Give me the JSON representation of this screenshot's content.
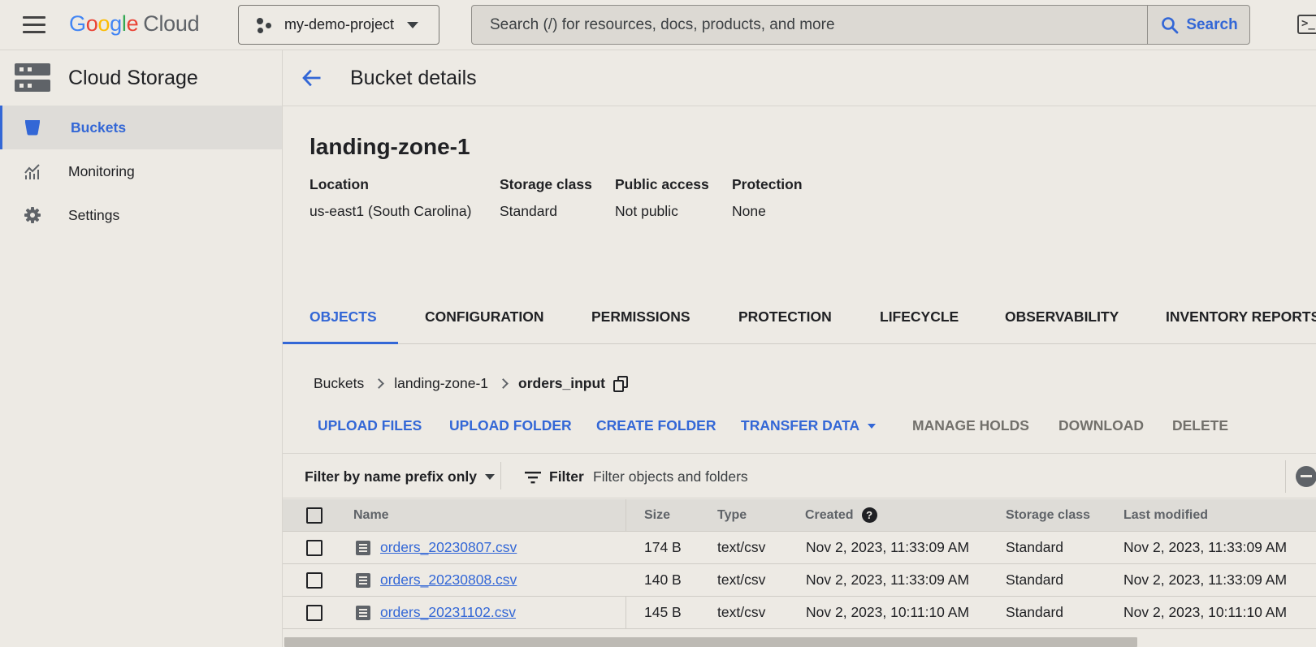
{
  "topbar": {
    "logo_google": [
      "G",
      "o",
      "o",
      "g",
      "l",
      "e"
    ],
    "logo_cloud": "Cloud",
    "project": "my-demo-project",
    "search_placeholder": "Search (/) for resources, docs, products, and more",
    "search_button": "Search"
  },
  "sidebar": {
    "title": "Cloud Storage",
    "items": [
      {
        "label": "Buckets",
        "icon": "bucket-icon",
        "active": true
      },
      {
        "label": "Monitoring",
        "icon": "monitoring-chart-icon",
        "active": false
      },
      {
        "label": "Settings",
        "icon": "gear-icon",
        "active": false
      }
    ]
  },
  "page": {
    "title": "Bucket details",
    "bucket_name": "landing-zone-1",
    "info": [
      {
        "key": "Location",
        "value": "us-east1 (South Carolina)"
      },
      {
        "key": "Storage class",
        "value": "Standard"
      },
      {
        "key": "Public access",
        "value": "Not public"
      },
      {
        "key": "Protection",
        "value": "None"
      }
    ]
  },
  "tabs": [
    "OBJECTS",
    "CONFIGURATION",
    "PERMISSIONS",
    "PROTECTION",
    "LIFECYCLE",
    "OBSERVABILITY",
    "INVENTORY REPORTS"
  ],
  "active_tab": "OBJECTS",
  "breadcrumb": [
    "Buckets",
    "landing-zone-1",
    "orders_input"
  ],
  "actions": {
    "upload_files": "UPLOAD FILES",
    "upload_folder": "UPLOAD FOLDER",
    "create_folder": "CREATE FOLDER",
    "transfer_data": "TRANSFER DATA",
    "manage_holds": "MANAGE HOLDS",
    "download": "DOWNLOAD",
    "delete": "DELETE"
  },
  "filter": {
    "mode": "Filter by name prefix only",
    "label": "Filter",
    "placeholder": "Filter objects and folders"
  },
  "table": {
    "columns": [
      "Name",
      "Size",
      "Type",
      "Created",
      "Storage class",
      "Last modified"
    ],
    "rows": [
      [
        "orders_20230807.csv",
        "174 B",
        "text/csv",
        "Nov 2, 2023, 11:33:09 AM",
        "Standard",
        "Nov 2, 2023, 11:33:09 AM"
      ],
      [
        "orders_20230808.csv",
        "140 B",
        "text/csv",
        "Nov 2, 2023, 11:33:09 AM",
        "Standard",
        "Nov 2, 2023, 11:33:09 AM"
      ],
      [
        "orders_20231102.csv",
        "145 B",
        "text/csv",
        "Nov 2, 2023, 10:11:10 AM",
        "Standard",
        "Nov 2, 2023, 10:11:10 AM"
      ]
    ]
  },
  "colors": {
    "accent": "#3367d6",
    "background": "#edeae4",
    "disabled_action": "#72706b"
  }
}
